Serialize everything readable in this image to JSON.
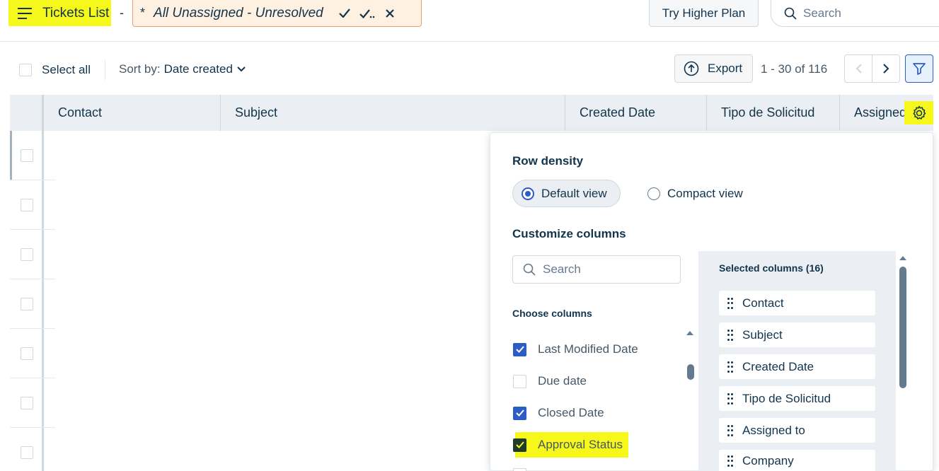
{
  "header": {
    "title": "Tickets List",
    "dash": "-",
    "view_prefix": "*",
    "view_name": "All Unassigned - Unresolved",
    "try_button": "Try Higher Plan",
    "search_placeholder": "Search"
  },
  "toolbar": {
    "select_all": "Select all",
    "sort_label": "Sort by:",
    "sort_value": "Date created",
    "export": "Export",
    "pager": "1 - 30 of 116"
  },
  "table": {
    "columns": [
      "Contact",
      "Subject",
      "Created Date",
      "Tipo de Solicitud",
      "Assigned"
    ]
  },
  "panel": {
    "row_density_title": "Row density",
    "default_view": "Default view",
    "compact_view": "Compact view",
    "customize_title": "Customize columns",
    "search_placeholder": "Search",
    "choose_title": "Choose columns",
    "choose_items": [
      {
        "label": "Last Modified Date",
        "checked": true
      },
      {
        "label": "Due date",
        "checked": false
      },
      {
        "label": "Closed Date",
        "checked": true
      },
      {
        "label": "Approval Status",
        "checked": true
      }
    ],
    "selected_title": "Selected columns (16)",
    "selected_items": [
      "Contact",
      "Subject",
      "Created Date",
      "Tipo de Solicitud",
      "Assigned to",
      "Company"
    ]
  },
  "colors": {
    "highlight": "#f6f71a",
    "accent": "#2c5cc5",
    "view_chip_bg": "#fef1e1",
    "view_chip_border": "#e2a46a"
  }
}
